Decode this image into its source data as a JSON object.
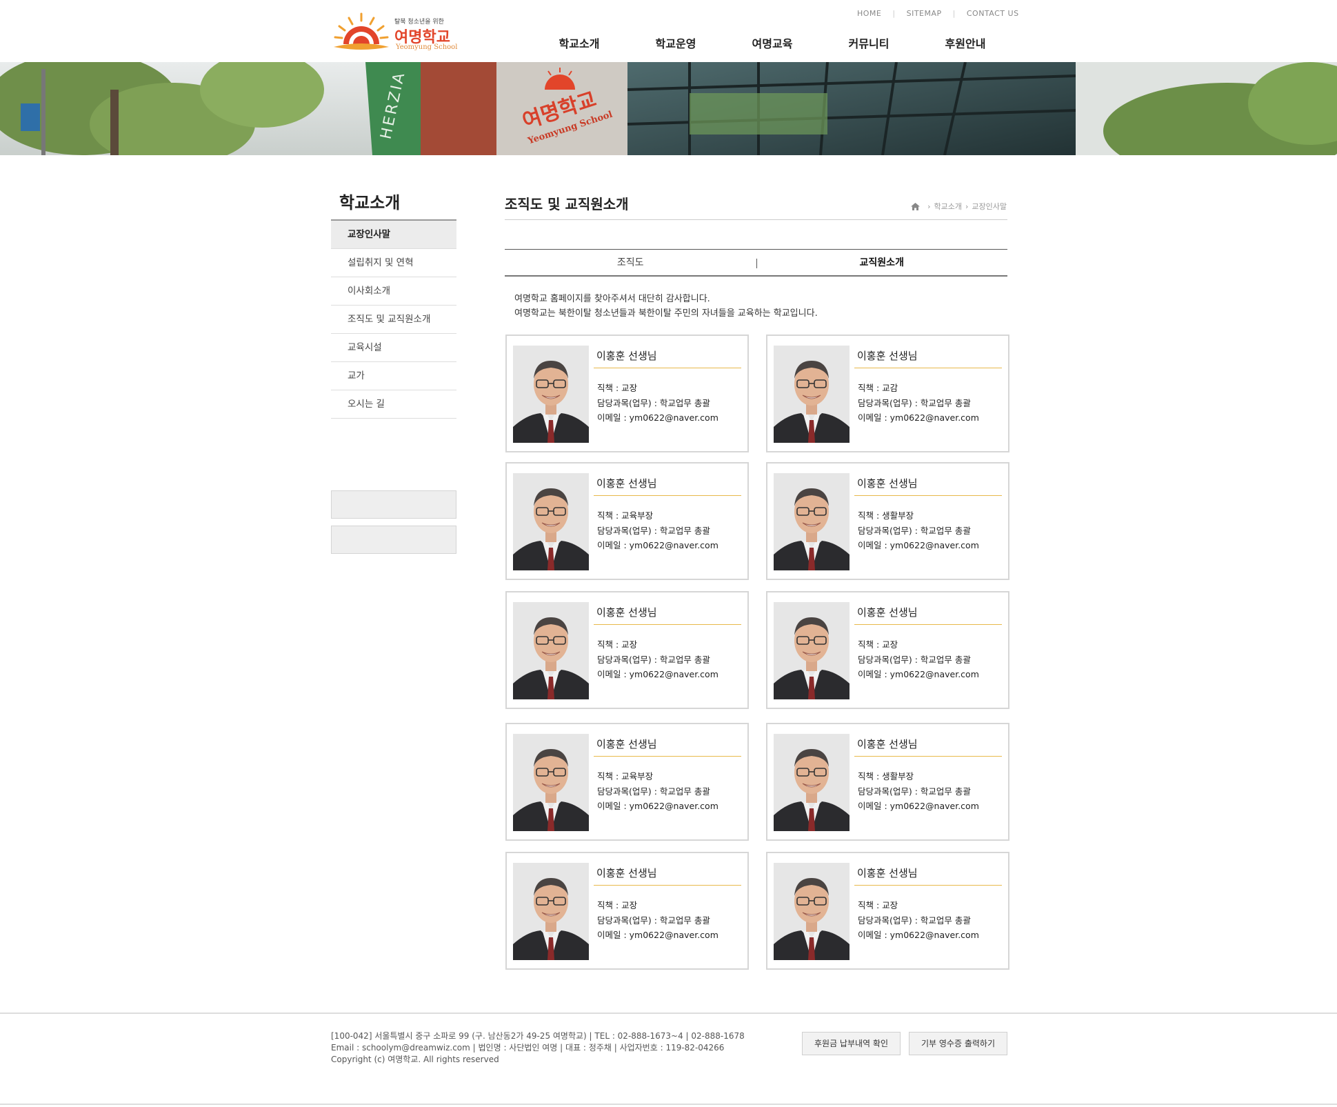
{
  "header": {
    "logo_tagline": "탈북 청소년을 위한",
    "logo_name": "여명학교",
    "logo_en": "Yeomyung School",
    "util": [
      "HOME",
      "SITEMAP",
      "CONTACT US"
    ],
    "gnb": [
      "학교소개",
      "학교운영",
      "여명교육",
      "커뮤니티",
      "후원안내"
    ]
  },
  "banner": {
    "sign_ko": "여명학교",
    "sign_en": "Yeomyung School",
    "wall_text": "HERZIA"
  },
  "sidebar": {
    "title": "학교소개",
    "items": [
      "교장인사말",
      "설립취지 및 연혁",
      "이사회소개",
      "조직도 및 교직원소개",
      "교육시설",
      "교가",
      "오시는 길"
    ],
    "active_index": 0
  },
  "content": {
    "title": "조직도 및 교직원소개",
    "breadcrumb": [
      "학교소개",
      "교장인사말"
    ],
    "tabs": [
      "조직도",
      "교직원소개"
    ],
    "active_tab": 1,
    "intro": [
      "여명학교 홈페이지를 찾아주셔서 대단히 감사합니다.",
      "여명학교는 북한이탈 청소년들과 북한이탈 주민의 자녀들을 교육하는 학교입니다."
    ]
  },
  "staff": [
    {
      "name": "이홍훈 선생님",
      "role": "직책 : 교장",
      "subject": "담당과목(업무) : 학교업무 총괄",
      "email": "이메일 : ym0622@naver.com"
    },
    {
      "name": "이홍훈 선생님",
      "role": "직책 : 교감",
      "subject": "담당과목(업무) : 학교업무 총괄",
      "email": "이메일 : ym0622@naver.com"
    },
    {
      "name": "이홍훈 선생님",
      "role": "직책 : 교육부장",
      "subject": "담당과목(업무) : 학교업무 총괄",
      "email": "이메일 : ym0622@naver.com"
    },
    {
      "name": "이홍훈 선생님",
      "role": "직책 : 생활부장",
      "subject": "담당과목(업무) : 학교업무 총괄",
      "email": "이메일 : ym0622@naver.com"
    },
    {
      "name": "이홍훈 선생님",
      "role": "직책 : 교장",
      "subject": "담당과목(업무) : 학교업무 총괄",
      "email": "이메일 : ym0622@naver.com"
    },
    {
      "name": "이홍훈 선생님",
      "role": "직책 : 교장",
      "subject": "담당과목(업무) : 학교업무 총괄",
      "email": "이메일 : ym0622@naver.com"
    },
    {
      "name": "이홍훈 선생님",
      "role": "직책 : 교육부장",
      "subject": "담당과목(업무) : 학교업무 총괄",
      "email": "이메일 : ym0622@naver.com"
    },
    {
      "name": "이홍훈 선생님",
      "role": "직책 : 생활부장",
      "subject": "담당과목(업무) : 학교업무 총괄",
      "email": "이메일 : ym0622@naver.com"
    },
    {
      "name": "이홍훈 선생님",
      "role": "직책 : 교장",
      "subject": "담당과목(업무) : 학교업무 총괄",
      "email": "이메일 : ym0622@naver.com"
    },
    {
      "name": "이홍훈 선생님",
      "role": "직책 : 교장",
      "subject": "담당과목(업무) : 학교업무 총괄",
      "email": "이메일 : ym0622@naver.com"
    }
  ],
  "footer": {
    "lines": [
      "[100-042] 서울특별시 중구 소파로 99 (구. 남산동2가 49-25 여명학교) | TEL : 02-888-1673~4 | 02-888-1678",
      "Email : schoolym@dreamwiz.com | 법인명 : 사단법인 여명 | 대표 : 정주채 | 사업자번호 : 119-82-04266",
      "Copyright (c) 여명학교. All rights reserved"
    ],
    "buttons": [
      "후원금 납부내역 확인",
      "기부 영수증 출력하기"
    ]
  },
  "colors": {
    "accent_rule": "#e8b94a",
    "logo_red": "#e2452a",
    "logo_orange": "#e08a3a"
  }
}
